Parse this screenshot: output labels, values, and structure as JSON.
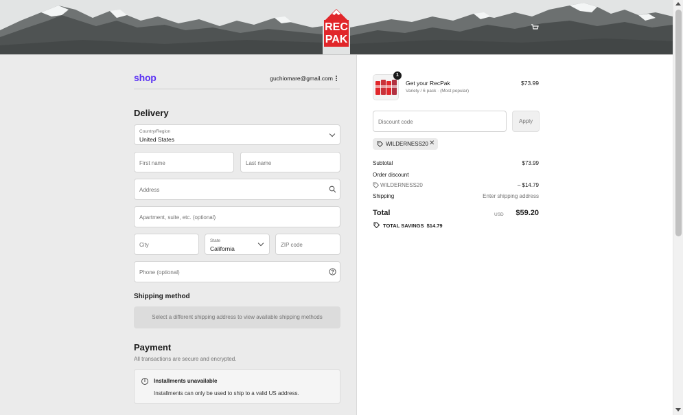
{
  "brand": {
    "logo_line1": "REC",
    "logo_line2": "PAK",
    "accent": "#e1262a",
    "shop_color": "#5a31f4"
  },
  "account": {
    "shop_label": "shop",
    "email": "guchiomare@gmail.com"
  },
  "delivery": {
    "heading": "Delivery",
    "country_label": "Country/Region",
    "country_value": "United States",
    "first_name_placeholder": "First name",
    "last_name_placeholder": "Last name",
    "address_placeholder": "Address",
    "apartment_placeholder": "Apartment, suite, etc. (optional)",
    "city_placeholder": "City",
    "state_label": "State",
    "state_value": "California",
    "zip_placeholder": "ZIP code",
    "phone_placeholder": "Phone (optional)"
  },
  "shipping_method": {
    "heading": "Shipping method",
    "message": "Select a different shipping address to view available shipping methods"
  },
  "payment": {
    "heading": "Payment",
    "subtitle": "All transactions are secure and encrypted.",
    "notice_title": "Installments unavailable",
    "notice_body": "Installments can only be used to ship to a valid US address."
  },
  "order": {
    "item": {
      "quantity": "1",
      "name": "Get your RecPak",
      "variant": "Variety / 6 pack · (Most popular)",
      "price": "$73.99"
    },
    "discount_placeholder": "Discount code",
    "apply_label": "Apply",
    "applied_code": "WILDERNESS20",
    "summary": {
      "subtotal_label": "Subtotal",
      "subtotal_value": "$73.99",
      "order_discount_label": "Order discount",
      "discount_code": "WILDERNESS20",
      "discount_value": "– $14.79",
      "shipping_label": "Shipping",
      "shipping_value": "Enter shipping address",
      "total_label": "Total",
      "total_currency": "USD",
      "total_value": "$59.20",
      "savings_label": "TOTAL SAVINGS",
      "savings_value": "$14.79"
    }
  }
}
